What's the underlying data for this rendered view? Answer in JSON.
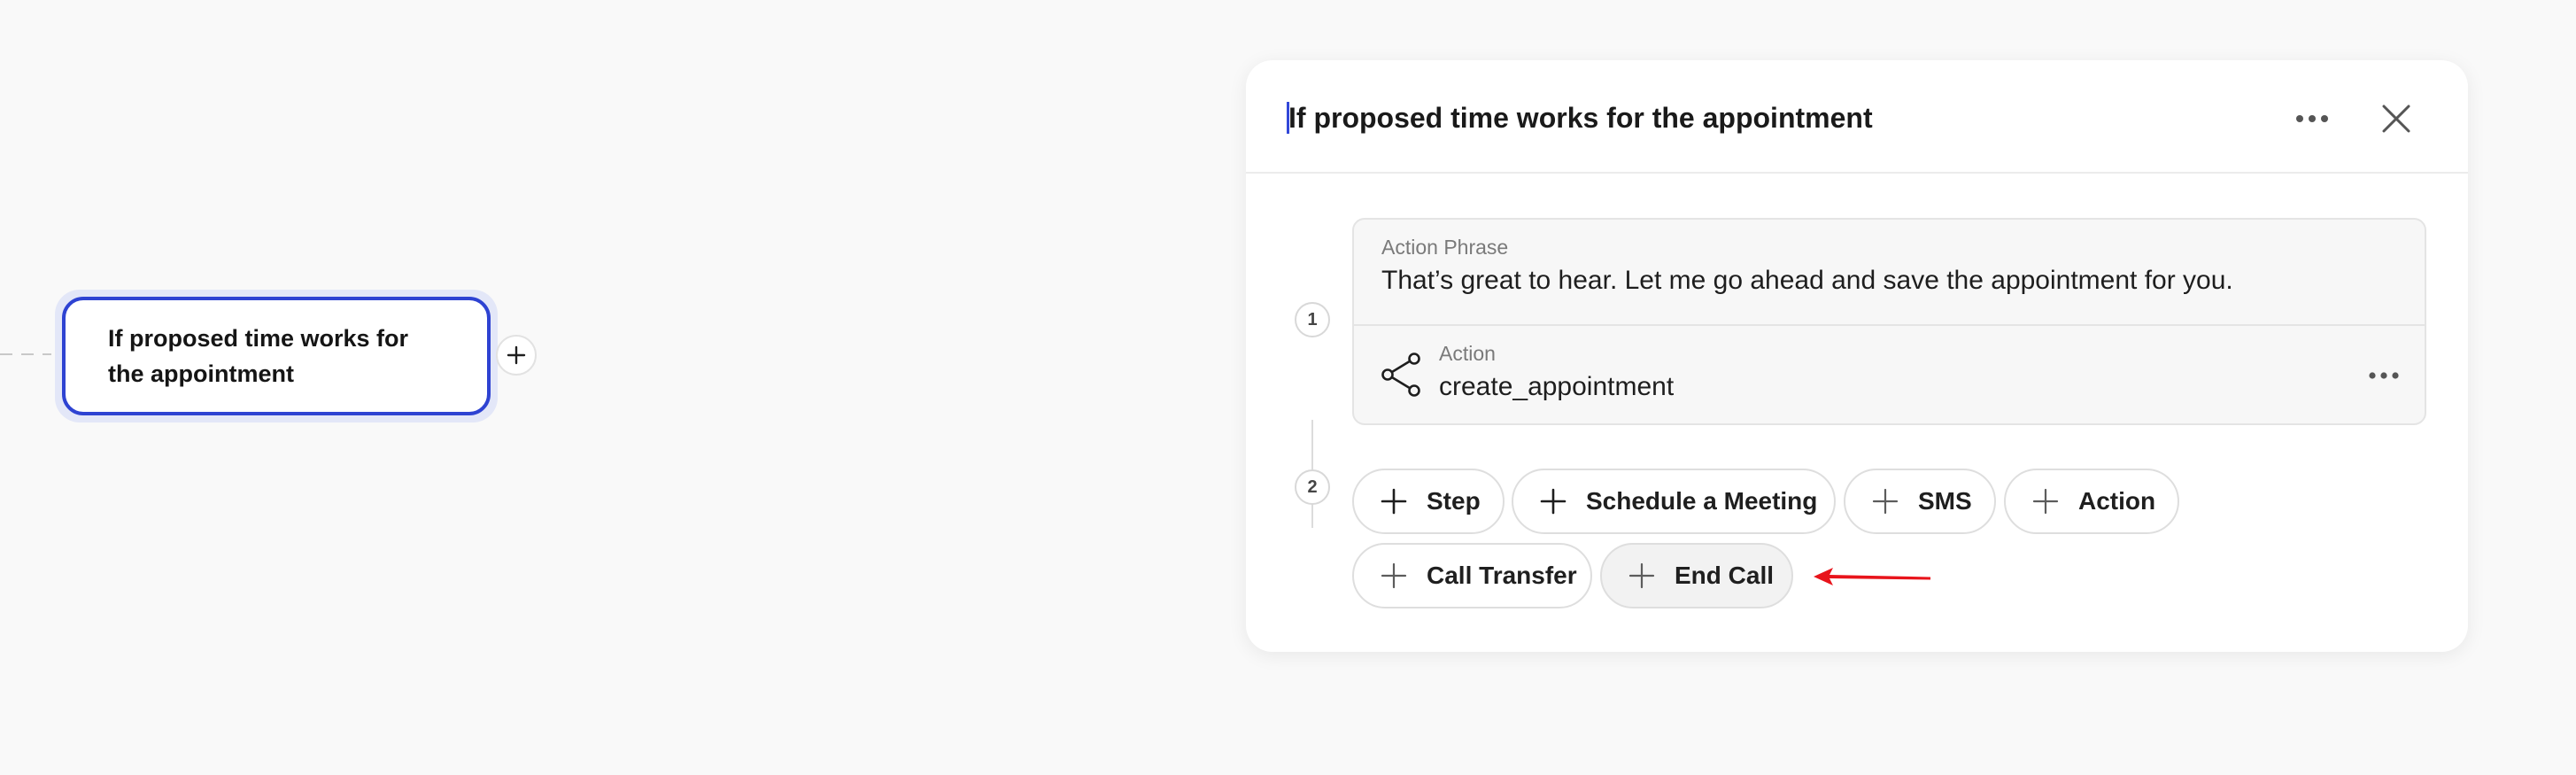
{
  "canvas": {
    "node": {
      "title": "If proposed time works for the appointment",
      "add_button": "plus-icon"
    }
  },
  "panel": {
    "title": "If proposed time works for the appointment",
    "more_icon": "more-horizontal-icon",
    "close_icon": "close-icon",
    "steps": [
      {
        "number": "1",
        "action_phrase_label": "Action Phrase",
        "action_phrase": "That’s great to hear. Let me go ahead and save the appointment for you.",
        "action_label": "Action",
        "action_value": "create_appointment",
        "action_icon": "share-node-icon"
      },
      {
        "number": "2"
      }
    ],
    "add_buttons": [
      {
        "label": "Step",
        "icon": "plus-icon"
      },
      {
        "label": "Schedule a Meeting",
        "icon": "plus-icon"
      },
      {
        "label": "SMS",
        "icon": "plus-icon"
      },
      {
        "label": "Action",
        "icon": "plus-icon"
      },
      {
        "label": "Call Transfer",
        "icon": "plus-icon"
      },
      {
        "label": "End Call",
        "icon": "plus-icon"
      }
    ]
  },
  "annotation": {
    "arrow_color": "#e8141b",
    "arrow_points_to": "End Call"
  },
  "colors": {
    "accent": "#2e43d2",
    "background": "#f9f9f9",
    "panel": "#ffffff"
  }
}
